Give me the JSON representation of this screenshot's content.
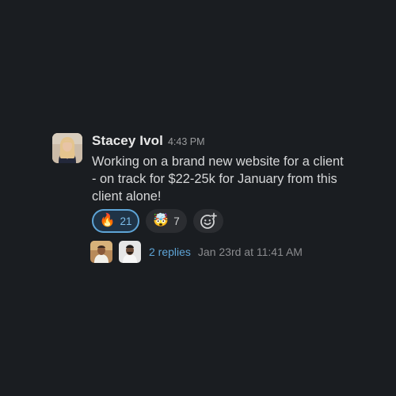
{
  "message": {
    "sender": "Stacey Ivol",
    "time": "4:43 PM",
    "text": "Working on a brand new website for a client - on track for $22-25k for January from this client alone!",
    "avatar_icon": "person-avatar-icon"
  },
  "reactions": [
    {
      "emoji": "🔥",
      "emoji_icon": "fire-icon",
      "count": "21",
      "selected": true
    },
    {
      "emoji": "🤯",
      "emoji_icon": "exploding-head-icon",
      "count": "7",
      "selected": false
    }
  ],
  "add_reaction_icon": "add-reaction-icon",
  "thread": {
    "replies": "2 replies",
    "last_reply": "Jan 23rd at 11:41 AM"
  },
  "colors": {
    "background": "#1a1d21",
    "link": "#5ea4d6",
    "selected_reaction_bg": "#1f3346"
  }
}
